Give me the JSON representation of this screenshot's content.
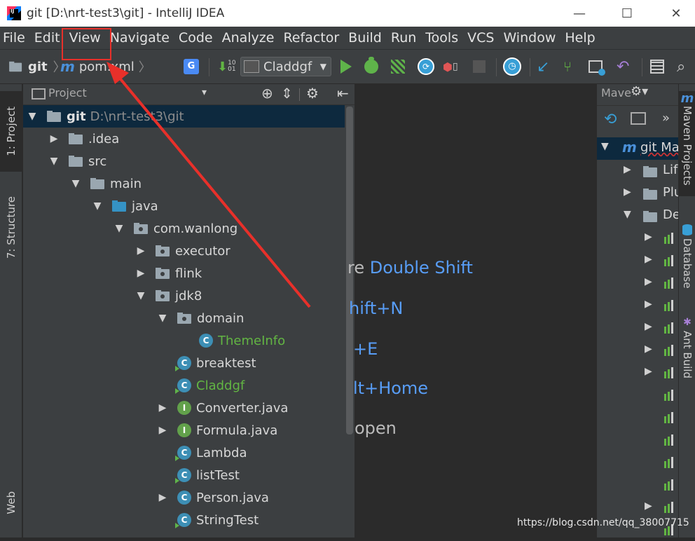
{
  "window": {
    "title": "git [D:\\nrt-test3\\git] - IntelliJ IDEA",
    "minimize": "—",
    "maximize": "☐",
    "close": "✕"
  },
  "menu": [
    "File",
    "Edit",
    "View",
    "Navigate",
    "Code",
    "Analyze",
    "Refactor",
    "Build",
    "Run",
    "Tools",
    "VCS",
    "Window",
    "Help"
  ],
  "navbar": {
    "crumb_project": "git",
    "crumb_file": "pom.xml",
    "run_config": "Claddgf"
  },
  "left_tabs": {
    "project": "1: Project",
    "structure": "7: Structure",
    "web": "Web"
  },
  "project_panel": {
    "title": "Project",
    "dropdown": "▾"
  },
  "tree": [
    {
      "label": "git",
      "path": "D:\\nrt-test3\\git",
      "arrow": "▼",
      "type": "module"
    },
    {
      "label": ".idea",
      "arrow": "▶",
      "type": "folder"
    },
    {
      "label": "src",
      "arrow": "▼",
      "type": "folder"
    },
    {
      "label": "main",
      "arrow": "▼",
      "type": "folder"
    },
    {
      "label": "java",
      "arrow": "▼",
      "type": "source"
    },
    {
      "label": "com.wanlong",
      "arrow": "▼",
      "type": "package"
    },
    {
      "label": "executor",
      "arrow": "▶",
      "type": "package"
    },
    {
      "label": "flink",
      "arrow": "▶",
      "type": "package"
    },
    {
      "label": "jdk8",
      "arrow": "▼",
      "type": "package"
    },
    {
      "label": "domain",
      "arrow": "▼",
      "type": "package"
    },
    {
      "label": "ThemeInfo",
      "arrow": "",
      "type": "class",
      "color": "#62b543"
    },
    {
      "label": "breaktest",
      "arrow": "",
      "type": "class-run"
    },
    {
      "label": "Claddgf",
      "arrow": "",
      "type": "class-run",
      "color": "#62b543"
    },
    {
      "label": "Converter.java",
      "arrow": "▶",
      "type": "interface"
    },
    {
      "label": "Formula.java",
      "arrow": "▶",
      "type": "interface"
    },
    {
      "label": "Lambda",
      "arrow": "",
      "type": "class-run"
    },
    {
      "label": "listTest",
      "arrow": "",
      "type": "class-run"
    },
    {
      "label": "Person.java",
      "arrow": "▶",
      "type": "class"
    },
    {
      "label": "StringTest",
      "arrow": "",
      "type": "class-run"
    }
  ],
  "editor_hints": [
    {
      "text": "re ",
      "key": "Double Shift"
    },
    {
      "text": "",
      "key": "hift+N"
    },
    {
      "text": "",
      "key": "+E"
    },
    {
      "text": "",
      "key": "lt+Home"
    },
    {
      "text": " open",
      "key": ""
    }
  ],
  "maven": {
    "title": "Mave",
    "root": "git Ma",
    "items": [
      "Lif",
      "Plu",
      "De"
    ]
  },
  "right_tabs": {
    "maven": "Maven Projects",
    "database": "Database",
    "ant": "Ant Build"
  },
  "watermark": "https://blog.csdn.net/qq_38007715",
  "colors": {
    "accent_red": "#e8302a",
    "shortcut_blue": "#589df6",
    "green_text": "#62b543"
  }
}
